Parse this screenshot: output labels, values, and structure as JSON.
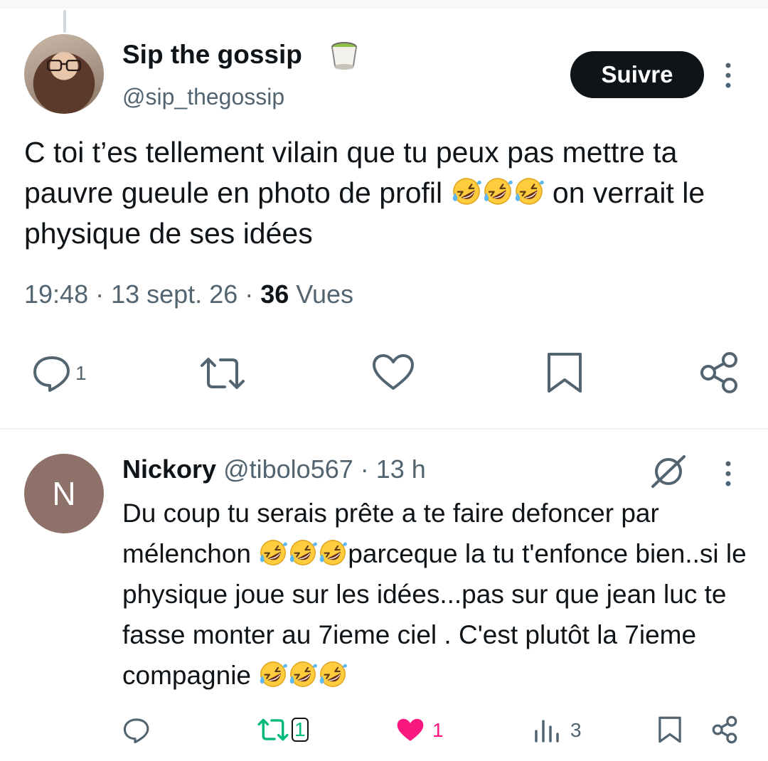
{
  "tweet": {
    "author_name": "Sip the gossip",
    "author_handle": "@sip_thegossip",
    "follow_label": "Suivre",
    "text_part1": "C toi t’es tellement vilain que tu peux pas mettre ta pauvre gueule en photo de profil ",
    "text_part2": " on verrait le physique de ses idées",
    "time": "19:48",
    "date": "13 sept. 26",
    "views_count": "36",
    "views_label": "Vues",
    "reply_count": "1"
  },
  "reply": {
    "avatar_letter": "N",
    "author_name": "Nickory",
    "author_handle": "@tibolo567",
    "age": "13 h",
    "text_part1": "Du coup tu serais prête a te faire defoncer par mélenchon ",
    "text_part2": "parceque la tu t'enfonce bien..si le physique joue sur les idées...pas sur que jean luc te fasse monter au 7ieme ciel . C'est plutôt la 7ieme compagnie ",
    "retweet_count": "1",
    "like_count": "1",
    "views_count": "3"
  },
  "icons": {
    "emoji": "rolling-on-floor-laughing",
    "cup": "matcha-cup",
    "reply": "comment-icon",
    "retweet": "retweet-icon",
    "like": "heart-icon",
    "bookmark": "bookmark-icon",
    "share": "share-icon",
    "views": "views-icon",
    "grok": "grok-icon"
  },
  "colors": {
    "text": "#0f1419",
    "muted": "#536471",
    "retweet_active": "#00ba7c",
    "like_active": "#f91880",
    "button_bg": "#0f1419"
  }
}
